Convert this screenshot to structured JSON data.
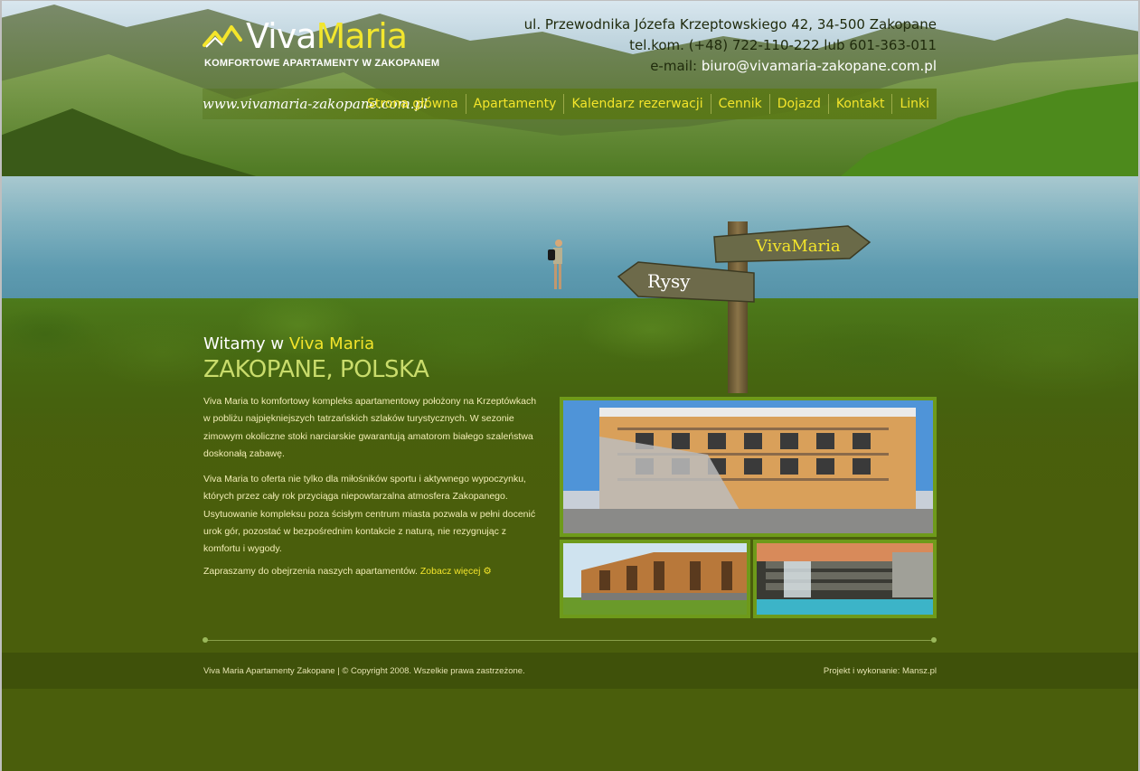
{
  "logo": {
    "brand_part1": "Viva",
    "brand_part2": "Maria",
    "tagline": "KOMFORTOWE APARTAMENTY W ZAKOPANEM"
  },
  "contact": {
    "address": "ul. Przewodnika Józefa Krzeptowskiego 42, 34-500 Zakopane",
    "phone": "tel.kom. (+48) 722-110-222 lub 601-363-011",
    "email_label": "e-mail:",
    "email": "biuro@vivamaria-zakopane.com.pl"
  },
  "site_url": "www.vivamaria-zakopane.com.pl",
  "nav": {
    "items": [
      {
        "label": "Strona główna"
      },
      {
        "label": "Apartamenty"
      },
      {
        "label": "Kalendarz rezerwacji"
      },
      {
        "label": "Cennik"
      },
      {
        "label": "Dojazd"
      },
      {
        "label": "Kontakt"
      },
      {
        "label": "Linki"
      }
    ]
  },
  "signs": {
    "right": "VivaMaria",
    "left": "Rysy"
  },
  "welcome": {
    "prefix": "Witamy w",
    "brand": "Viva Maria",
    "location": "ZAKOPANE, POLSKA"
  },
  "content": {
    "p1": "Viva Maria to komfortowy kompleks apartamentowy położony na Krzeptówkach w pobliżu najpiękniejszych tatrzańskich szlaków turystycznych. W sezonie zimowym okoliczne stoki narciarskie gwarantują amatorom białego szaleństwa doskonałą zabawę.",
    "p2": "Viva Maria to oferta nie tylko dla miłośników sportu i aktywnego wypoczynku, których przez cały rok przyciąga niepowtarzalna atmosfera Zakopanego. Usytuowanie kompleksu poza ścisłym centrum miasta pozwala w pełni docenić urok gór, pozostać w bezpośrednim kontakcie z naturą, nie rezygnując z komfortu i wygody.",
    "p3_text": "Zapraszamy do obejrzenia naszych apartamentów.",
    "p3_link": "Zobacz więcej"
  },
  "footer": {
    "left": "Viva Maria Apartamenty Zakopane | © Copyright 2008. Wszelkie prawa zastrzeżone.",
    "right": "Projekt i wykonanie: Mansz.pl"
  },
  "colors": {
    "accent_yellow": "#f4e52b",
    "background_green": "#4a5e0c",
    "frame_green": "#6e9a1a"
  }
}
